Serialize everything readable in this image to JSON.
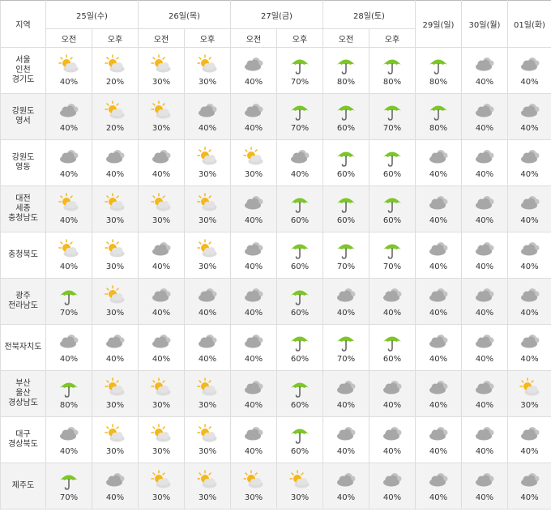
{
  "header": {
    "region_label": "지역",
    "am_label": "오전",
    "pm_label": "오후",
    "days_split": [
      "25일(수)",
      "26일(목)",
      "27일(금)",
      "28일(토)"
    ],
    "days_single": [
      "29일(일)",
      "30일(월)",
      "01일(화)"
    ]
  },
  "rows": [
    {
      "name": [
        "서울",
        "인천",
        "경기도"
      ],
      "cells": [
        {
          "icon": "partly-sunny",
          "pct": "40%"
        },
        {
          "icon": "partly-sunny",
          "pct": "20%"
        },
        {
          "icon": "partly-sunny",
          "pct": "30%"
        },
        {
          "icon": "partly-sunny",
          "pct": "30%"
        },
        {
          "icon": "cloudy",
          "pct": "40%"
        },
        {
          "icon": "umbrella",
          "pct": "70%"
        },
        {
          "icon": "umbrella",
          "pct": "80%"
        },
        {
          "icon": "umbrella",
          "pct": "80%"
        },
        {
          "icon": "umbrella",
          "pct": "80%"
        },
        {
          "icon": "cloudy",
          "pct": "40%"
        },
        {
          "icon": "cloudy",
          "pct": "40%"
        }
      ]
    },
    {
      "name": [
        "강원도",
        "영서"
      ],
      "cells": [
        {
          "icon": "cloudy",
          "pct": "40%"
        },
        {
          "icon": "partly-sunny",
          "pct": "20%"
        },
        {
          "icon": "partly-sunny",
          "pct": "30%"
        },
        {
          "icon": "cloudy",
          "pct": "40%"
        },
        {
          "icon": "cloudy",
          "pct": "40%"
        },
        {
          "icon": "umbrella",
          "pct": "70%"
        },
        {
          "icon": "umbrella",
          "pct": "60%"
        },
        {
          "icon": "umbrella",
          "pct": "70%"
        },
        {
          "icon": "umbrella",
          "pct": "80%"
        },
        {
          "icon": "cloudy",
          "pct": "40%"
        },
        {
          "icon": "cloudy",
          "pct": "40%"
        }
      ]
    },
    {
      "name": [
        "강원도",
        "영동"
      ],
      "cells": [
        {
          "icon": "cloudy",
          "pct": "40%"
        },
        {
          "icon": "cloudy",
          "pct": "40%"
        },
        {
          "icon": "cloudy",
          "pct": "40%"
        },
        {
          "icon": "partly-sunny",
          "pct": "30%"
        },
        {
          "icon": "partly-sunny",
          "pct": "30%"
        },
        {
          "icon": "cloudy",
          "pct": "40%"
        },
        {
          "icon": "umbrella",
          "pct": "60%"
        },
        {
          "icon": "umbrella",
          "pct": "60%"
        },
        {
          "icon": "cloudy",
          "pct": "40%"
        },
        {
          "icon": "cloudy",
          "pct": "40%"
        },
        {
          "icon": "cloudy",
          "pct": "40%"
        }
      ]
    },
    {
      "name": [
        "대전",
        "세종",
        "충청남도"
      ],
      "cells": [
        {
          "icon": "partly-sunny",
          "pct": "40%"
        },
        {
          "icon": "partly-sunny",
          "pct": "30%"
        },
        {
          "icon": "partly-sunny",
          "pct": "30%"
        },
        {
          "icon": "partly-sunny",
          "pct": "30%"
        },
        {
          "icon": "cloudy",
          "pct": "40%"
        },
        {
          "icon": "umbrella",
          "pct": "60%"
        },
        {
          "icon": "umbrella",
          "pct": "60%"
        },
        {
          "icon": "umbrella",
          "pct": "60%"
        },
        {
          "icon": "cloudy",
          "pct": "40%"
        },
        {
          "icon": "cloudy",
          "pct": "40%"
        },
        {
          "icon": "cloudy",
          "pct": "40%"
        }
      ]
    },
    {
      "name": [
        "충청북도"
      ],
      "cells": [
        {
          "icon": "partly-sunny",
          "pct": "40%"
        },
        {
          "icon": "partly-sunny",
          "pct": "30%"
        },
        {
          "icon": "cloudy",
          "pct": "40%"
        },
        {
          "icon": "partly-sunny",
          "pct": "30%"
        },
        {
          "icon": "cloudy",
          "pct": "40%"
        },
        {
          "icon": "umbrella",
          "pct": "60%"
        },
        {
          "icon": "umbrella",
          "pct": "70%"
        },
        {
          "icon": "umbrella",
          "pct": "70%"
        },
        {
          "icon": "cloudy",
          "pct": "40%"
        },
        {
          "icon": "cloudy",
          "pct": "40%"
        },
        {
          "icon": "cloudy",
          "pct": "40%"
        }
      ]
    },
    {
      "name": [
        "광주",
        "전라남도"
      ],
      "cells": [
        {
          "icon": "umbrella",
          "pct": "70%"
        },
        {
          "icon": "partly-sunny",
          "pct": "30%"
        },
        {
          "icon": "cloudy",
          "pct": "40%"
        },
        {
          "icon": "cloudy",
          "pct": "40%"
        },
        {
          "icon": "cloudy",
          "pct": "40%"
        },
        {
          "icon": "umbrella",
          "pct": "60%"
        },
        {
          "icon": "cloudy",
          "pct": "40%"
        },
        {
          "icon": "cloudy",
          "pct": "40%"
        },
        {
          "icon": "cloudy",
          "pct": "40%"
        },
        {
          "icon": "cloudy",
          "pct": "40%"
        },
        {
          "icon": "cloudy",
          "pct": "40%"
        }
      ]
    },
    {
      "name": [
        "전북자치도"
      ],
      "cells": [
        {
          "icon": "cloudy",
          "pct": "40%"
        },
        {
          "icon": "cloudy",
          "pct": "40%"
        },
        {
          "icon": "cloudy",
          "pct": "40%"
        },
        {
          "icon": "cloudy",
          "pct": "40%"
        },
        {
          "icon": "cloudy",
          "pct": "40%"
        },
        {
          "icon": "umbrella",
          "pct": "60%"
        },
        {
          "icon": "umbrella",
          "pct": "70%"
        },
        {
          "icon": "umbrella",
          "pct": "60%"
        },
        {
          "icon": "cloudy",
          "pct": "40%"
        },
        {
          "icon": "cloudy",
          "pct": "40%"
        },
        {
          "icon": "cloudy",
          "pct": "40%"
        }
      ]
    },
    {
      "name": [
        "부산",
        "울산",
        "경상남도"
      ],
      "cells": [
        {
          "icon": "umbrella",
          "pct": "80%"
        },
        {
          "icon": "partly-sunny",
          "pct": "30%"
        },
        {
          "icon": "partly-sunny",
          "pct": "30%"
        },
        {
          "icon": "partly-sunny",
          "pct": "30%"
        },
        {
          "icon": "cloudy",
          "pct": "40%"
        },
        {
          "icon": "umbrella",
          "pct": "60%"
        },
        {
          "icon": "cloudy",
          "pct": "40%"
        },
        {
          "icon": "cloudy",
          "pct": "40%"
        },
        {
          "icon": "cloudy",
          "pct": "40%"
        },
        {
          "icon": "cloudy",
          "pct": "40%"
        },
        {
          "icon": "partly-sunny",
          "pct": "30%"
        }
      ]
    },
    {
      "name": [
        "대구",
        "경상북도"
      ],
      "cells": [
        {
          "icon": "cloudy",
          "pct": "40%"
        },
        {
          "icon": "partly-sunny",
          "pct": "30%"
        },
        {
          "icon": "partly-sunny",
          "pct": "30%"
        },
        {
          "icon": "partly-sunny",
          "pct": "30%"
        },
        {
          "icon": "cloudy",
          "pct": "40%"
        },
        {
          "icon": "umbrella",
          "pct": "60%"
        },
        {
          "icon": "cloudy",
          "pct": "40%"
        },
        {
          "icon": "cloudy",
          "pct": "40%"
        },
        {
          "icon": "cloudy",
          "pct": "40%"
        },
        {
          "icon": "cloudy",
          "pct": "40%"
        },
        {
          "icon": "cloudy",
          "pct": "40%"
        }
      ]
    },
    {
      "name": [
        "제주도"
      ],
      "cells": [
        {
          "icon": "umbrella",
          "pct": "70%"
        },
        {
          "icon": "cloudy",
          "pct": "40%"
        },
        {
          "icon": "partly-sunny",
          "pct": "30%"
        },
        {
          "icon": "partly-sunny",
          "pct": "30%"
        },
        {
          "icon": "partly-sunny",
          "pct": "30%"
        },
        {
          "icon": "partly-sunny",
          "pct": "30%"
        },
        {
          "icon": "cloudy",
          "pct": "40%"
        },
        {
          "icon": "cloudy",
          "pct": "40%"
        },
        {
          "icon": "cloudy",
          "pct": "40%"
        },
        {
          "icon": "cloudy",
          "pct": "40%"
        },
        {
          "icon": "cloudy",
          "pct": "40%"
        }
      ]
    }
  ],
  "colors": {
    "umbrella": "#7cc628",
    "sun": "#f5b71b",
    "cloud": "#a7a7a7",
    "border": "#dddddd",
    "stripe": "#f3f3f3"
  }
}
